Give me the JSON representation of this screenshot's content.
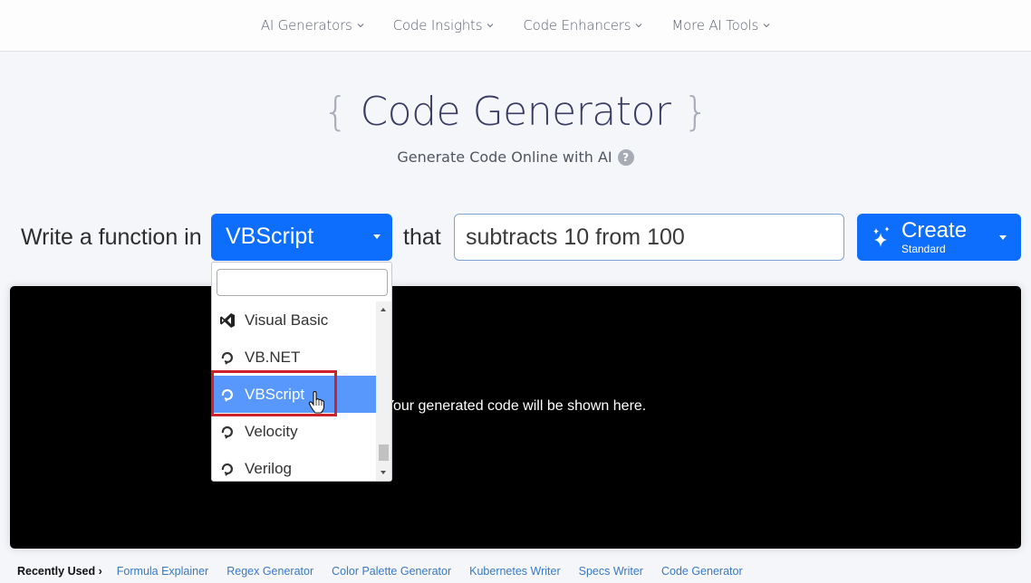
{
  "nav": {
    "items": [
      {
        "label": "AI Generators"
      },
      {
        "label": "Code Insights"
      },
      {
        "label": "Code Enhancers"
      },
      {
        "label": "More AI Tools"
      }
    ]
  },
  "hero": {
    "brace_open": "{",
    "title": "Code Generator",
    "brace_close": "}",
    "subtitle": "Generate Code Online with AI",
    "help_glyph": "?"
  },
  "prompt": {
    "prefix": "Write a function in",
    "language": "VBScript",
    "connector": "that",
    "task_value": "subtracts 10 from 100",
    "create_label": "Create",
    "create_mode": "Standard"
  },
  "dropdown": {
    "search_value": "",
    "items": [
      {
        "label": "Visual Basic",
        "icon": "visual-studio-icon"
      },
      {
        "label": "VB.NET",
        "icon": "code-generic-icon"
      },
      {
        "label": "VBScript",
        "icon": "code-generic-icon",
        "selected": true
      },
      {
        "label": "Velocity",
        "icon": "code-generic-icon"
      },
      {
        "label": "Verilog",
        "icon": "code-generic-icon"
      }
    ]
  },
  "output": {
    "placeholder": "Your generated code will be shown here."
  },
  "recently_used": {
    "label": "Recently Used ›",
    "links": [
      {
        "label": "Formula Explainer"
      },
      {
        "label": "Regex Generator"
      },
      {
        "label": "Color Palette Generator"
      },
      {
        "label": "Kubernetes Writer"
      },
      {
        "label": "Specs Writer"
      },
      {
        "label": "Code Generator"
      }
    ]
  },
  "colors": {
    "primary": "#0d6efd",
    "selected_option": "#5897fb",
    "highlight": "#d0202a"
  }
}
